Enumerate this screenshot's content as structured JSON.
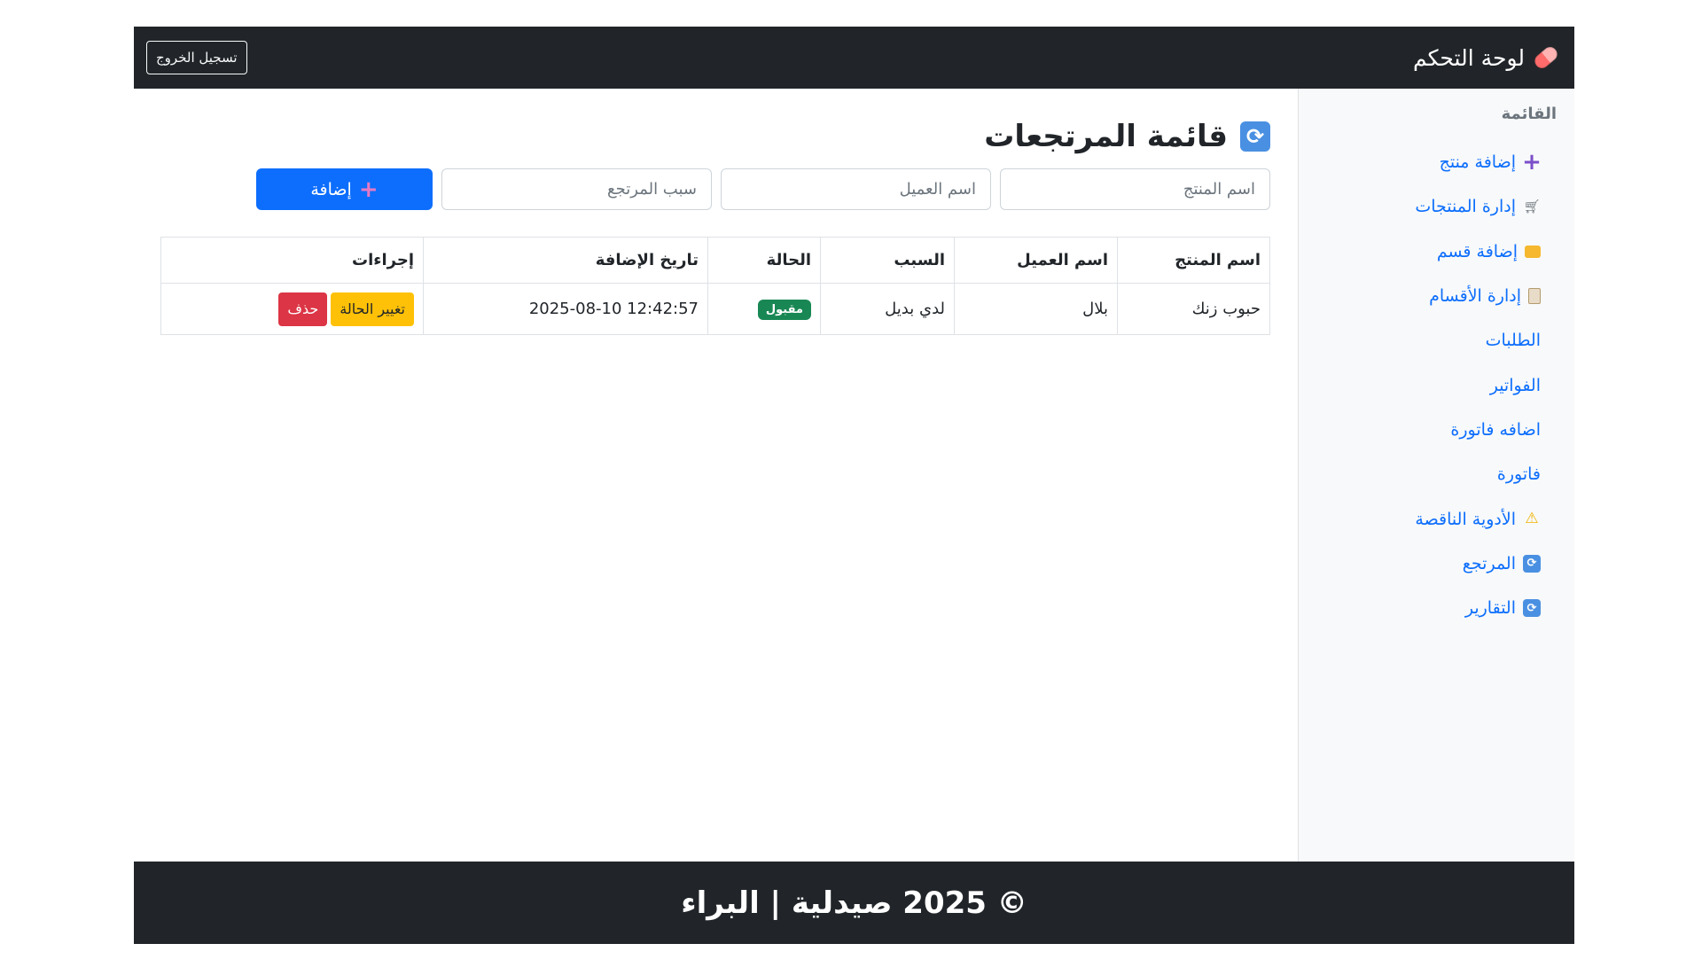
{
  "navbar": {
    "brand": "لوحة التحكم",
    "logout_label": "تسجيل الخروج"
  },
  "sidebar": {
    "title": "القائمة",
    "items": [
      {
        "label": "إضافة منتج",
        "icon": "plus-icon"
      },
      {
        "label": "إدارة المنتجات",
        "icon": "cart-icon"
      },
      {
        "label": "إضافة قسم",
        "icon": "folder-icon"
      },
      {
        "label": "إدارة الأقسام",
        "icon": "clipboard-icon"
      },
      {
        "label": "الطلبات",
        "icon": ""
      },
      {
        "label": "الفواتير",
        "icon": ""
      },
      {
        "label": "اضافه فاتورة",
        "icon": ""
      },
      {
        "label": "فاتورة",
        "icon": ""
      },
      {
        "label": "الأدوية الناقصة",
        "icon": "warning-icon"
      },
      {
        "label": "المرتجع",
        "icon": "refresh-icon"
      },
      {
        "label": "التقارير",
        "icon": "refresh-icon"
      }
    ]
  },
  "main": {
    "title": "قائمة المرتجعات",
    "form": {
      "product_placeholder": "اسم المنتج",
      "customer_placeholder": "اسم العميل",
      "reason_placeholder": "سبب المرتجع",
      "add_label": "إضافة"
    },
    "table": {
      "headers": [
        "اسم المنتج",
        "اسم العميل",
        "السبب",
        "الحالة",
        "تاريخ الإضافة",
        "إجراءات"
      ],
      "rows": [
        {
          "product": "حبوب زنك",
          "customer": "بلال",
          "reason": "لدي بديل",
          "status": "مقبول",
          "date": "2025-08-10 12:42:57",
          "change_status_label": "تغيير الحالة",
          "delete_label": "حذف"
        }
      ]
    }
  },
  "footer": {
    "text": "© 2025 صيدلية | البراء"
  },
  "colors": {
    "navbar_bg": "#212529",
    "primary": "#0d6efd",
    "success": "#198754",
    "warning": "#ffc107",
    "danger": "#dc3545"
  }
}
